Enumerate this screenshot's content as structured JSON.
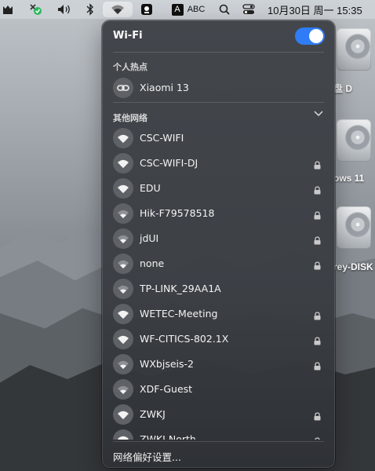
{
  "menubar": {
    "input_badge": "A",
    "input_method": "ABC",
    "datetime": "10月30日 周一  15:35"
  },
  "desktop": {
    "drives": [
      {
        "label": "盘 D"
      },
      {
        "label": "ows 11"
      },
      {
        "label": "rey-DISK"
      }
    ]
  },
  "wifi_panel": {
    "title": "Wi-Fi",
    "toggle_on": true,
    "accent": "#2f7cf6",
    "hotspot_header": "个人热点",
    "hotspot": {
      "name": "Xiaomi 13",
      "icon": "link-icon"
    },
    "other_header": "其他网络",
    "networks": [
      {
        "name": "CSC-WIFI",
        "locked": false,
        "strength": 3
      },
      {
        "name": "CSC-WIFI-DJ",
        "locked": true,
        "strength": 3
      },
      {
        "name": "EDU",
        "locked": true,
        "strength": 3
      },
      {
        "name": "Hik-F79578518",
        "locked": true,
        "strength": 2
      },
      {
        "name": "jdUI",
        "locked": true,
        "strength": 2
      },
      {
        "name": "none",
        "locked": true,
        "strength": 2
      },
      {
        "name": "TP-LINK_29AA1A",
        "locked": false,
        "strength": 2
      },
      {
        "name": "WETEC-Meeting",
        "locked": true,
        "strength": 3
      },
      {
        "name": "WF-CITICS-802.1X",
        "locked": true,
        "strength": 3
      },
      {
        "name": "WXbjseis-2",
        "locked": true,
        "strength": 2
      },
      {
        "name": "XDF-Guest",
        "locked": false,
        "strength": 2
      },
      {
        "name": "ZWKJ",
        "locked": true,
        "strength": 3
      },
      {
        "name": "ZWKJ-North",
        "locked": true,
        "strength": 3
      }
    ],
    "footer": "网络偏好设置..."
  }
}
